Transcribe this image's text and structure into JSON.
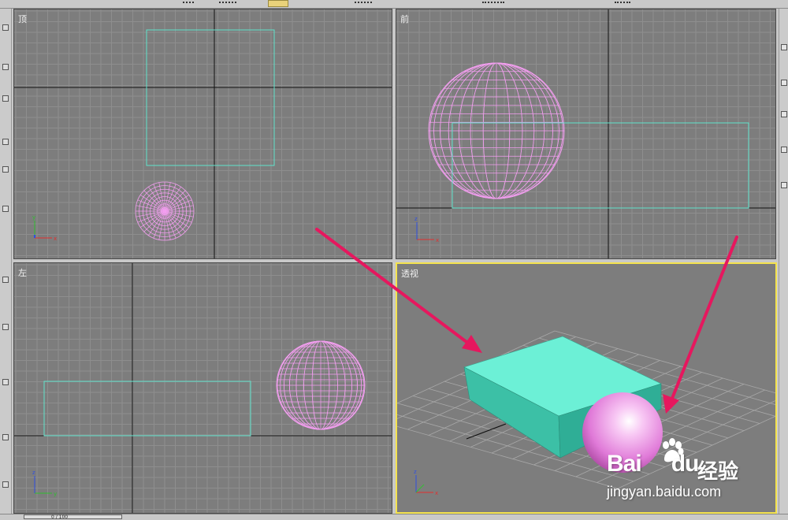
{
  "viewports": {
    "top": {
      "label": "顶"
    },
    "front": {
      "label": "前"
    },
    "left": {
      "label": "左"
    },
    "perspective": {
      "label": "透视",
      "active": true
    }
  },
  "axis_labels": {
    "x": "x",
    "y": "y",
    "z": "z"
  },
  "status": {
    "frame_counter": "0 / 100"
  },
  "watermark": {
    "logo": "Bai",
    "logo_tail": "du",
    "chinese": "经验",
    "url": "jingyan.baidu.com"
  },
  "colors": {
    "viewport_bg": "#7d7d7d",
    "grid": "#8e8e8e",
    "axis_line": "#111111",
    "box_wire": "#5fe3cc",
    "box_fill": "#55e0c4",
    "sphere_wire": "#f39ef0",
    "active_border": "#f4e34e",
    "arrow": "#e6175e"
  },
  "icons": [
    "selection-tool-icon",
    "arrow-annotation-icon",
    "baidu-paw-icon"
  ]
}
